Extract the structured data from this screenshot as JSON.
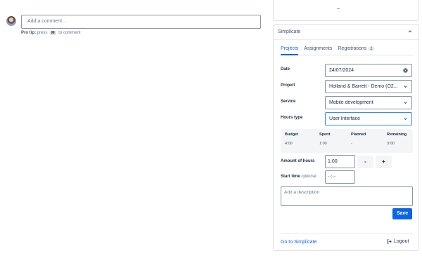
{
  "comment": {
    "placeholder": "Add a comment...",
    "protip_label": "Pro tip:",
    "protip_text_before": "press",
    "protip_key": "M",
    "protip_text_after": "to comment"
  },
  "panel": {
    "title": "Simplicate",
    "tabs": [
      {
        "label": "Projects",
        "active": true
      },
      {
        "label": "Assignments"
      },
      {
        "label": "Registrations",
        "count": "2"
      }
    ],
    "fields": {
      "date_label": "Date",
      "date_value": "24/07/2024",
      "project_label": "Project",
      "project_value": "Holland & Barrett - Demo (O2...",
      "service_label": "Service",
      "service_value": "Mobile development",
      "hours_type_label": "Hours type",
      "hours_type_value": "User Interface"
    },
    "summary": {
      "headers": [
        "Budget",
        "Spent",
        "Planned",
        "Remaining"
      ],
      "values": [
        "4:00",
        "1:00",
        "-",
        "3:00"
      ]
    },
    "amount": {
      "label": "Amount of hours",
      "value": "1:00",
      "minus": "-",
      "plus": "+"
    },
    "start_time": {
      "label": "Start time",
      "optional": "optional",
      "placeholder": "--:--"
    },
    "description_placeholder": "Add a description",
    "save_label": "Save",
    "goto_label": "Go to Simplicate",
    "logout_label": "Logout"
  },
  "colors": {
    "accent": "#0c66e4",
    "focus": "#388bff"
  }
}
